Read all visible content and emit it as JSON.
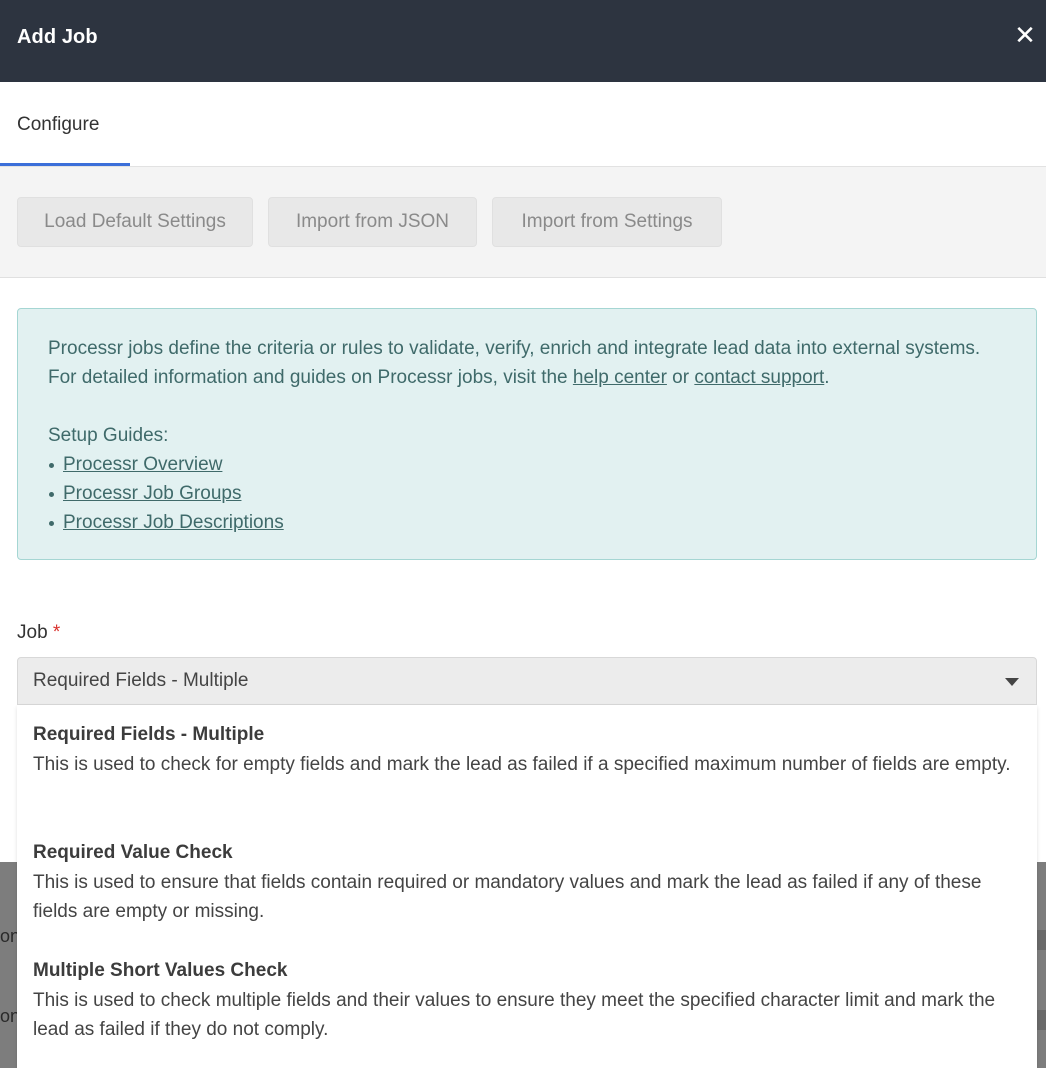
{
  "modal": {
    "title": "Add Job",
    "close_icon": "close-icon"
  },
  "tabs": [
    {
      "label": "Configure",
      "active": true
    }
  ],
  "toolbar": {
    "load_default_label": "Load Default Settings",
    "import_json_label": "Import from JSON",
    "import_settings_label": "Import from Settings"
  },
  "info": {
    "line1": "Processr jobs define the criteria or rules to validate, verify, enrich and integrate lead data into external systems.",
    "line2_prefix": "For detailed information and guides on Processr jobs, visit the ",
    "help_center_link": "help center",
    "line2_or": " or ",
    "contact_support_link": "contact support",
    "line2_suffix": ".",
    "setup_guides_heading": "Setup Guides:",
    "guides": [
      "Processr Overview",
      "Processr Job Groups",
      "Processr Job Descriptions"
    ]
  },
  "job_field": {
    "label": "Job",
    "required_marker": "*",
    "selected_value": "Required Fields - Multiple"
  },
  "dropdown_options": [
    {
      "title": "Required Fields - Multiple",
      "description": "This is used to check for empty fields and mark the lead as failed if a specified maximum number of fields are empty."
    },
    {
      "title": "Required Value Check",
      "description": "This is used to ensure that fields contain required or mandatory values and mark the lead as failed if any of these fields are empty or missing."
    },
    {
      "title": "Multiple Short Values Check",
      "description": "This is used to check multiple fields and their values to ensure they meet the specified character limit and mark the lead as failed if they do not comply."
    }
  ],
  "backdrop": {
    "fragment1": "on",
    "fragment2": "on"
  },
  "colors": {
    "header_bg": "#2d3440",
    "tab_accent": "#3b6fd9",
    "info_bg": "#e2f1f1",
    "info_border": "#a5d6d3",
    "required_star": "#d9302c"
  }
}
